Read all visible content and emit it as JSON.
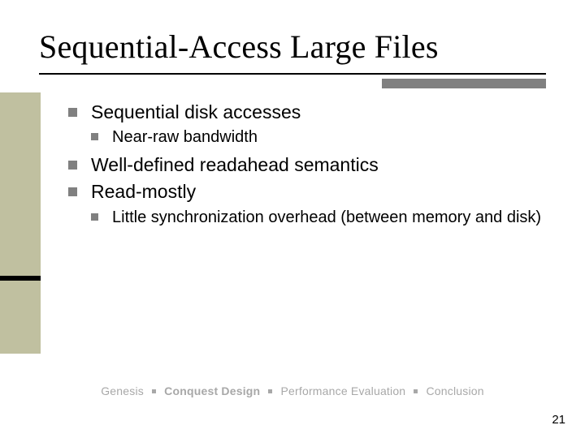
{
  "title": "Sequential-Access Large Files",
  "bullets": {
    "b1": "Sequential disk accesses",
    "b1a": "Near-raw bandwidth",
    "b2": "Well-defined readahead semantics",
    "b3": "Read-mostly",
    "b3a": "Little synchronization overhead (between memory and disk)"
  },
  "breadcrumb": {
    "s1": "Genesis",
    "s2": "Conquest Design",
    "s3": "Performance Evaluation",
    "s4": "Conclusion"
  },
  "page_number": "21"
}
